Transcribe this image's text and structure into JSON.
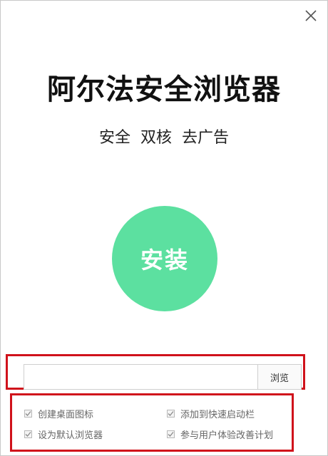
{
  "window": {
    "title": "阿尔法安全浏览器",
    "subtitle": "安全  双核  去广告"
  },
  "install": {
    "label": "安装"
  },
  "path": {
    "value": "",
    "browse_label": "浏览"
  },
  "options": [
    {
      "label": "创建桌面图标",
      "checked": true
    },
    {
      "label": "添加到快速启动栏",
      "checked": true
    },
    {
      "label": "设为默认浏览器",
      "checked": true
    },
    {
      "label": "参与用户体验改善计划",
      "checked": true
    }
  ],
  "colors": {
    "install_button": "#5ce0a0",
    "highlight_frame": "#d0121b"
  },
  "icons": {
    "close": "close-icon",
    "checkbox": "checkmark-icon"
  }
}
